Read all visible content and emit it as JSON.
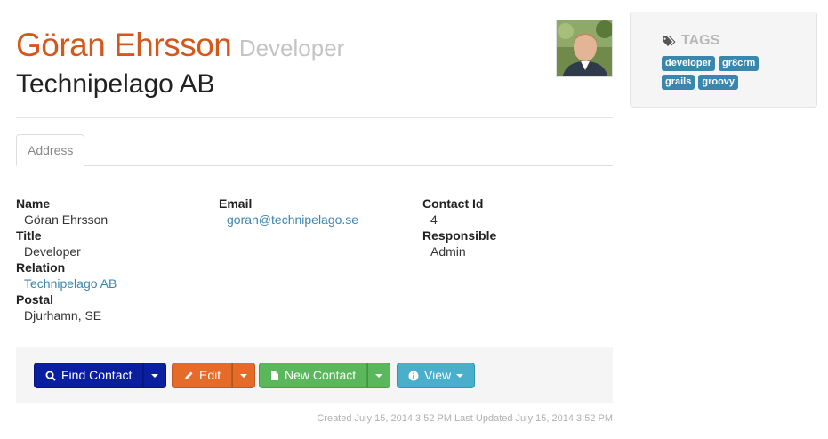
{
  "header": {
    "person_name": "Göran Ehrsson",
    "person_title": "Developer",
    "company": "Technipelago AB"
  },
  "tabs": [
    {
      "label": "Address",
      "active": true
    }
  ],
  "details": {
    "name_label": "Name",
    "name_value": "Göran Ehrsson",
    "title_label": "Title",
    "title_value": "Developer",
    "relation_label": "Relation",
    "relation_value": "Technipelago AB",
    "postal_label": "Postal",
    "postal_value": "Djurhamn, SE",
    "email_label": "Email",
    "email_value": "goran@technipelago.se",
    "contact_id_label": "Contact Id",
    "contact_id_value": "4",
    "responsible_label": "Responsible",
    "responsible_value": "Admin"
  },
  "actions": {
    "find_contact": "Find Contact",
    "edit": "Edit",
    "new_contact": "New Contact",
    "view": "View"
  },
  "footer": {
    "stamp": "Created July 15, 2014 3:52 PM Last Updated July 15, 2014 3:52 PM"
  },
  "sidebar": {
    "tags_heading": "TAGS",
    "tags": [
      "developer",
      "gr8crm",
      "grails",
      "groovy"
    ]
  },
  "colors": {
    "name_accent": "#d4581c",
    "link": "#3a87ad",
    "btn_find": "#0a1fa0",
    "btn_edit": "#e46b28",
    "btn_new": "#5bb75b",
    "btn_view": "#49afcd",
    "tag_bg": "#3a87ad"
  },
  "icons": {
    "find": "search-icon",
    "edit": "pencil-icon",
    "new": "file-icon",
    "view": "info-icon",
    "tags": "tags-icon"
  }
}
